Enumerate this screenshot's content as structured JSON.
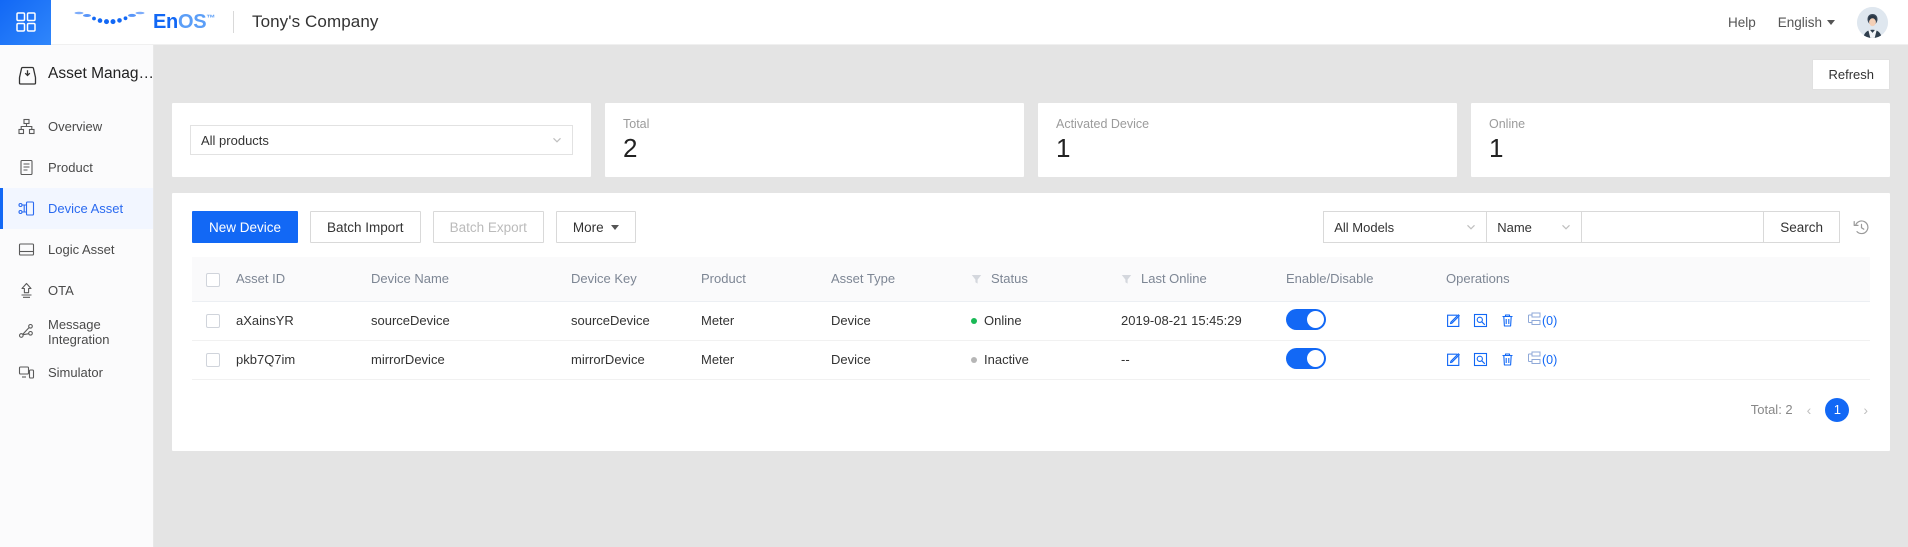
{
  "header": {
    "grid_icon": "grid-icon",
    "brand_en": "En",
    "brand_os": "OS",
    "brand_tm": "™",
    "company": "Tony's Company",
    "help": "Help",
    "language": "English",
    "avatar": "user-avatar"
  },
  "sidebar": {
    "title": "Asset Manag…",
    "items": [
      {
        "label": "Overview",
        "icon": "overview-icon",
        "active": false
      },
      {
        "label": "Product",
        "icon": "product-icon",
        "active": false
      },
      {
        "label": "Device Asset",
        "icon": "device-asset-icon",
        "active": true
      },
      {
        "label": "Logic Asset",
        "icon": "logic-asset-icon",
        "active": false
      },
      {
        "label": "OTA",
        "icon": "ota-icon",
        "active": false
      },
      {
        "label": "Message Integration",
        "icon": "message-integration-icon",
        "active": false
      },
      {
        "label": "Simulator",
        "icon": "simulator-icon",
        "active": false
      }
    ]
  },
  "main": {
    "refresh_label": "Refresh",
    "product_filter": {
      "value": "All products",
      "icon": "chevron-down-icon"
    },
    "stats": [
      {
        "label": "Total",
        "value": "2"
      },
      {
        "label": "Activated Device",
        "value": "1"
      },
      {
        "label": "Online",
        "value": "1"
      }
    ],
    "toolbar": {
      "new_device": "New Device",
      "batch_import": "Batch Import",
      "batch_export": "Batch Export",
      "more": "More",
      "model_filter": "All Models",
      "field_filter": "Name",
      "search_value": "",
      "search_placeholder": "",
      "search_button": "Search",
      "history_icon": "history-icon"
    },
    "table": {
      "columns": [
        {
          "label": "Asset ID",
          "filter": false
        },
        {
          "label": "Device Name",
          "filter": false
        },
        {
          "label": "Device Key",
          "filter": false
        },
        {
          "label": "Product",
          "filter": false
        },
        {
          "label": "Asset Type",
          "filter": false
        },
        {
          "label": "Status",
          "filter": true
        },
        {
          "label": "Last Online",
          "filter": true
        },
        {
          "label": "Enable/Disable",
          "filter": false
        },
        {
          "label": "Operations",
          "filter": false
        }
      ],
      "rows": [
        {
          "asset_id": "aXainsYR",
          "device_name": "sourceDevice",
          "device_key": "sourceDevice",
          "product": "Meter",
          "asset_type": "Device",
          "status": "Online",
          "status_color": "#19b955",
          "last_online": "2019-08-21 15:45:29",
          "enabled": true,
          "op_count": "(0)"
        },
        {
          "asset_id": "pkb7Q7im",
          "device_name": "mirrorDevice",
          "device_key": "mirrorDevice",
          "product": "Meter",
          "asset_type": "Device",
          "status": "Inactive",
          "status_color": "#b6b6b6",
          "last_online": "--",
          "enabled": true,
          "op_count": "(0)"
        }
      ]
    },
    "pagination": {
      "total": "Total: 2",
      "prev": "‹",
      "page": "1",
      "next": "›"
    }
  },
  "colors": {
    "primary": "#1268f5",
    "online": "#19b955",
    "inactive": "#b6b6b6",
    "page_bg": "#e4e4e4"
  }
}
